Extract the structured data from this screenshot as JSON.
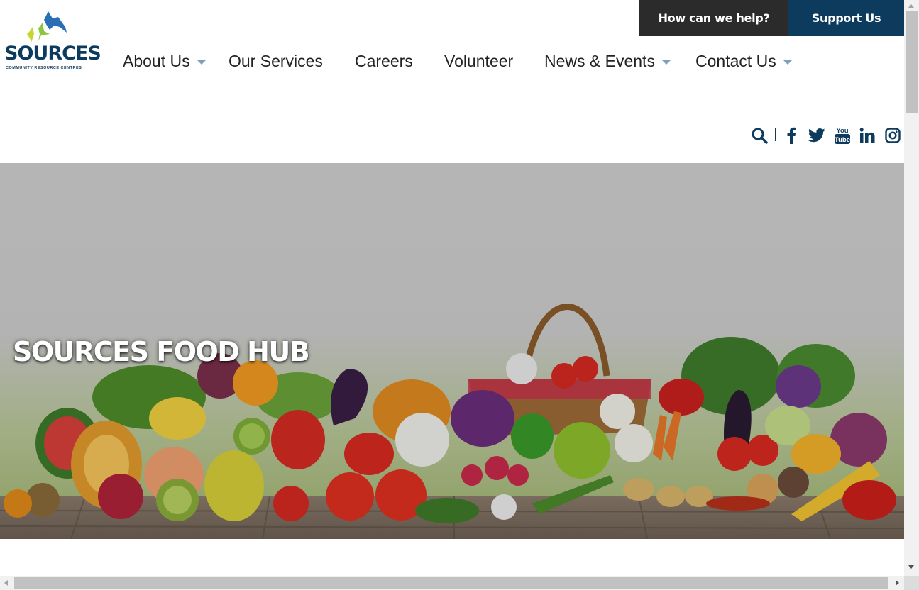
{
  "utility_bar": {
    "help_label": "How can we help?",
    "support_label": "Support Us"
  },
  "logo": {
    "wordmark": "SOURCES",
    "tagline": "COMMUNITY RESOURCE CENTRES"
  },
  "nav": {
    "items": [
      {
        "label": "About Us",
        "has_dropdown": true
      },
      {
        "label": "Our Services",
        "has_dropdown": false
      },
      {
        "label": "Careers",
        "has_dropdown": false
      },
      {
        "label": "Volunteer",
        "has_dropdown": false
      },
      {
        "label": "News & Events",
        "has_dropdown": true
      },
      {
        "label": "Contact Us",
        "has_dropdown": true
      }
    ]
  },
  "social": {
    "icons": [
      "search-icon",
      "facebook-icon",
      "twitter-icon",
      "youtube-icon",
      "linkedin-icon",
      "instagram-icon"
    ],
    "youtube_text_top": "You",
    "youtube_text_bottom": "Tube"
  },
  "hero": {
    "title": "SOURCES FOOD HUB"
  },
  "colors": {
    "brand_navy": "#0d3b5e",
    "dark_button": "#2b2b2b",
    "caret": "#7da0bf",
    "logo_blue": "#2a6fb5",
    "logo_green": "#8cc63f"
  }
}
